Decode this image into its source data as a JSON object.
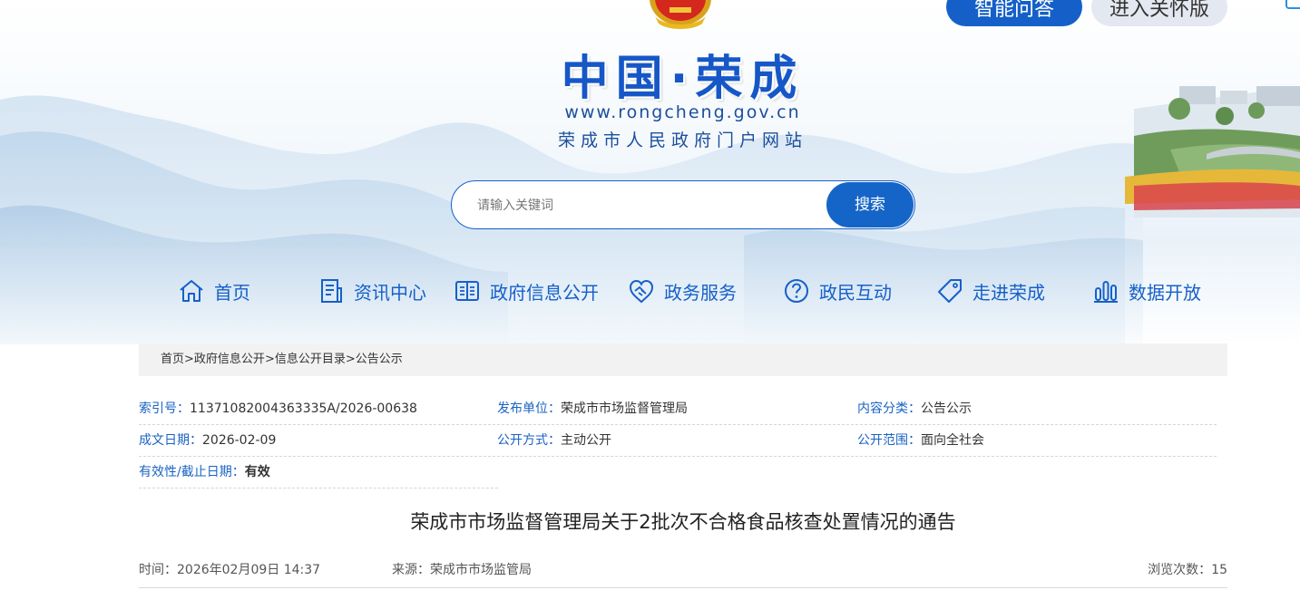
{
  "header": {
    "title": "中国·荣成",
    "url": "www.rongcheng.gov.cn",
    "subtitle": "荣成市人民政府门户网站",
    "ai_button": "智能问答",
    "care_button": "进入关怀版"
  },
  "search": {
    "placeholder": "请输入关键词",
    "button": "搜索"
  },
  "nav": {
    "items": [
      {
        "label": "首页",
        "icon": "home-icon"
      },
      {
        "label": "资讯中心",
        "icon": "document-list-icon"
      },
      {
        "label": "政府信息公开",
        "icon": "open-book-icon"
      },
      {
        "label": "政务服务",
        "icon": "handshake-heart-icon"
      },
      {
        "label": "政民互动",
        "icon": "question-circle-icon"
      },
      {
        "label": "走进荣成",
        "icon": "tag-icon"
      },
      {
        "label": "数据开放",
        "icon": "bar-chart-icon"
      }
    ]
  },
  "breadcrumb": {
    "items": [
      "首页",
      "政府信息公开",
      "信息公开目录",
      "公告公示"
    ],
    "separator": ">"
  },
  "info": {
    "index_label": "索引号：",
    "index_value": "11371082004363335A/2026-00638",
    "publisher_label": "发布单位：",
    "publisher_value": "荣成市市场监督管理局",
    "category_label": "内容分类：",
    "category_value": "公告公示",
    "date_label": "成文日期：",
    "date_value": "2026-02-09",
    "open_mode_label": "公开方式：",
    "open_mode_value": "主动公开",
    "scope_label": "公开范围：",
    "scope_value": "面向全社会",
    "validity_label": "有效性/截止日期：",
    "validity_value": "有效"
  },
  "article": {
    "title": "荣成市市场监督管理局关于2批次不合格食品核查处置情况的通告",
    "time": "时间：2026年02月09日 14:37",
    "source": "来源：荣成市市场监管局",
    "views": "浏览次数：15"
  },
  "colors": {
    "brand_blue": "#1560c8",
    "label_blue": "#1a63c2",
    "care_button_bg": "#e4e8f0",
    "breadcrumb_bg": "#f2f2f2"
  }
}
